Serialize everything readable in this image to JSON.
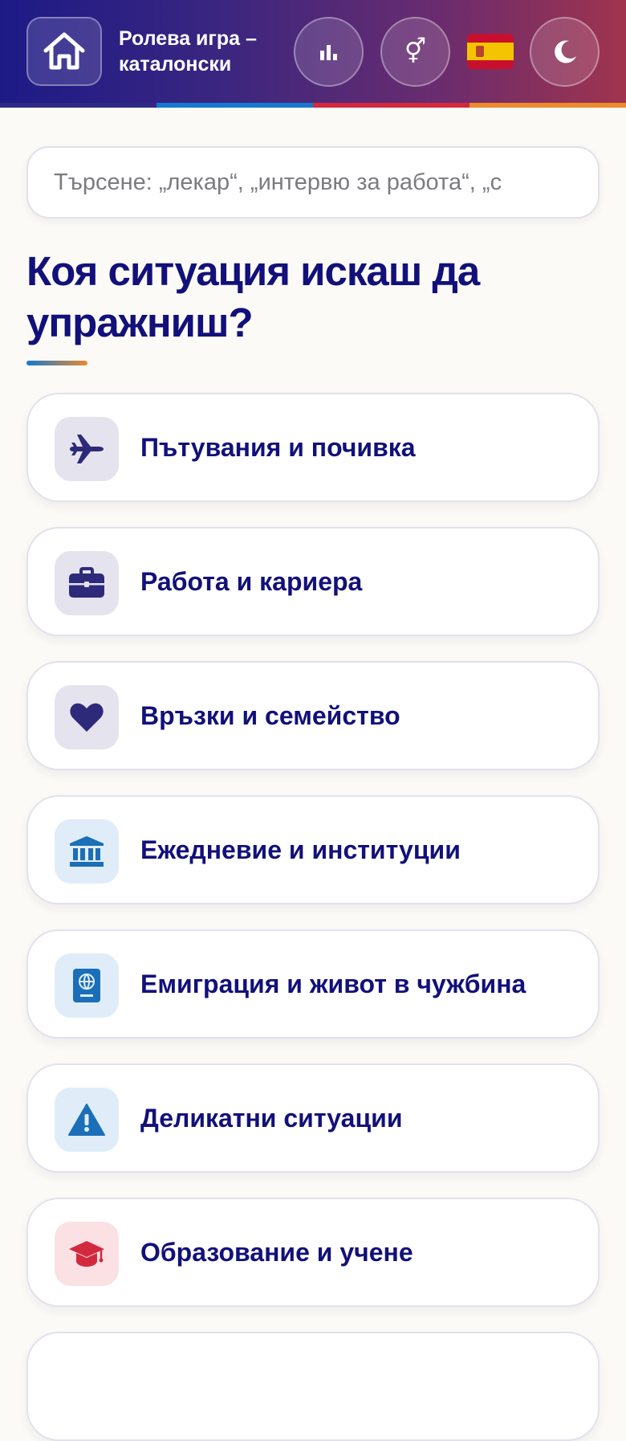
{
  "header": {
    "title": "Ролева игра – каталонски",
    "gender_symbol": "⚥"
  },
  "search": {
    "placeholder": "Търсене: „лекар“, „интервю за работа“, „с"
  },
  "heading": "Коя ситуация искаш да упражниш?",
  "categories": [
    {
      "label": "Пътувания и почивка",
      "icon": "airplane-icon"
    },
    {
      "label": "Работа и кариера",
      "icon": "briefcase-icon"
    },
    {
      "label": "Връзки и семейство",
      "icon": "heart-icon"
    },
    {
      "label": "Ежедневие и институции",
      "icon": "bank-icon"
    },
    {
      "label": "Емиграция и живот в чужбина",
      "icon": "passport-icon"
    },
    {
      "label": "Деликатни ситуации",
      "icon": "warning-icon"
    },
    {
      "label": "Образование и учене",
      "icon": "graduation-cap-icon"
    }
  ],
  "colors": {
    "primary": "#12107a",
    "accent_blue": "#1479cf",
    "accent_red": "#d3293f",
    "accent_orange": "#ec8a2c"
  }
}
